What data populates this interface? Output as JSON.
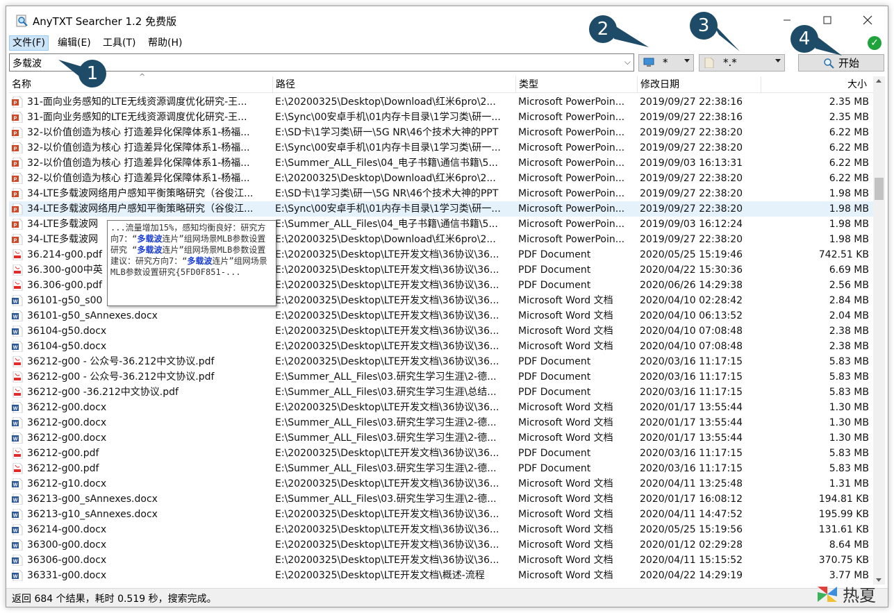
{
  "window": {
    "title": "AnyTXT Searcher 1.2 免费版"
  },
  "menu": [
    {
      "label": "文件(F)",
      "active": true
    },
    {
      "label": "编辑(E)",
      "active": false
    },
    {
      "label": "工具(T)",
      "active": false
    },
    {
      "label": "帮助(H)",
      "active": false
    }
  ],
  "search": {
    "value": "多载波"
  },
  "location_combo": {
    "value": "*"
  },
  "type_combo": {
    "value": "*.*"
  },
  "start_button": {
    "label": "开始"
  },
  "callouts": [
    "1",
    "2",
    "3",
    "4"
  ],
  "columns": {
    "name": "名称",
    "path": "路径",
    "type": "类型",
    "date": "修改日期",
    "size": "大小"
  },
  "rows": [
    {
      "icon": "ppt",
      "name": "31-面向业务感知的LTE无线资源调度优化研究-王...",
      "path": "E:\\20200325\\Desktop\\Download\\红米6pro\\2...",
      "type": "Microsoft PowerPoin...",
      "date": "2019/09/27  22:38:16",
      "size": "2.35 MB"
    },
    {
      "icon": "ppt",
      "name": "31-面向业务感知的LTE无线资源调度优化研究-王...",
      "path": "E:\\Sync\\00安卓手机\\01内存卡目录\\1学习类\\研一...",
      "type": "Microsoft PowerPoin...",
      "date": "2019/09/27  22:38:16",
      "size": "2.35 MB"
    },
    {
      "icon": "ppt",
      "name": "32-以价值创造为核心 打造差异化保障体系1-杨福...",
      "path": "E:\\SD卡\\1学习类\\研一\\5G NR\\46个技术大神的PPT",
      "type": "Microsoft PowerPoin...",
      "date": "2019/09/27  22:38:20",
      "size": "6.22 MB"
    },
    {
      "icon": "ppt",
      "name": "32-以价值创造为核心 打造差异化保障体系1-杨福...",
      "path": "E:\\Sync\\00安卓手机\\01内存卡目录\\1学习类\\研一...",
      "type": "Microsoft PowerPoin...",
      "date": "2019/09/27  22:38:20",
      "size": "6.22 MB"
    },
    {
      "icon": "ppt",
      "name": "32-以价值创造为核心 打造差异化保障体系1-杨福...",
      "path": "E:\\Summer_ALL_Files\\04_电子书籍\\通信书籍\\5...",
      "type": "Microsoft PowerPoin...",
      "date": "2019/09/03  16:13:31",
      "size": "6.22 MB"
    },
    {
      "icon": "ppt",
      "name": "32-以价值创造为核心 打造差异化保障体系1-杨福...",
      "path": "E:\\20200325\\Desktop\\Download\\红米6pro\\2...",
      "type": "Microsoft PowerPoin...",
      "date": "2019/09/27  22:38:20",
      "size": "6.22 MB"
    },
    {
      "icon": "ppt",
      "name": "34-LTE多载波网络用户感知平衡策略研究（谷俊江...",
      "path": "E:\\SD卡\\1学习类\\研一\\5G NR\\46个技术大神的PPT",
      "type": "Microsoft PowerPoin...",
      "date": "2019/09/27  22:38:20",
      "size": "1.98 MB"
    },
    {
      "icon": "ppt",
      "name": "34-LTE多载波网络用户感知平衡策略研究（谷俊江...",
      "path": "E:\\Sync\\00安卓手机\\01内存卡目录\\1学习类\\研一...",
      "type": "Microsoft PowerPoin...",
      "date": "2019/09/27  22:38:20",
      "size": "1.98 MB",
      "selected": true
    },
    {
      "icon": "ppt",
      "name": "34-LTE多载波网",
      "path": "E:\\Summer_ALL_Files\\04_电子书籍\\通信书籍\\5...",
      "type": "Microsoft PowerPoin...",
      "date": "2019/09/03  16:12:24",
      "size": "1.98 MB"
    },
    {
      "icon": "ppt",
      "name": "34-LTE多载波网",
      "path": "E:\\20200325\\Desktop\\Download\\红米6pro\\2...",
      "type": "Microsoft PowerPoin...",
      "date": "2019/09/27  22:38:20",
      "size": "1.98 MB"
    },
    {
      "icon": "pdf",
      "name": "36.214-g00.pdf",
      "path": "E:\\20200325\\Desktop\\LTE开发文档\\36协议\\36...",
      "type": "PDF Document",
      "date": "2020/05/25  15:19:46",
      "size": "742.51 KB"
    },
    {
      "icon": "pdf",
      "name": "36.300-g00中英",
      "path": "E:\\20200325\\Desktop\\LTE开发文档\\36协议\\36...",
      "type": "PDF Document",
      "date": "2020/04/22  15:30:36",
      "size": "6.69 MB"
    },
    {
      "icon": "pdf",
      "name": "36.306-g00.pdf",
      "path": "E:\\20200325\\Desktop\\LTE开发文档\\36协议\\36...",
      "type": "PDF Document",
      "date": "2020/06/26  14:29:38",
      "size": "2.56 MB"
    },
    {
      "icon": "word",
      "name": "36101-g50_s00",
      "path": "E:\\20200325\\Desktop\\LTE开发文档\\36协议\\36...",
      "type": "Microsoft Word 文档",
      "date": "2020/04/10  02:28:42",
      "size": "2.84 MB"
    },
    {
      "icon": "word",
      "name": "36101-g50_sAnnexes.docx",
      "path": "E:\\20200325\\Desktop\\LTE开发文档\\36协议\\36...",
      "type": "Microsoft Word 文档",
      "date": "2020/04/10  06:13:52",
      "size": "2.04 MB"
    },
    {
      "icon": "word",
      "name": "36104-g50.docx",
      "path": "E:\\20200325\\Desktop\\LTE开发文档\\36协议\\36...",
      "type": "Microsoft Word 文档",
      "date": "2020/04/10  07:08:48",
      "size": "2.38 MB"
    },
    {
      "icon": "word",
      "name": "36104-g50.docx",
      "path": "E:\\20200325\\Desktop\\LTE开发文档\\36协议\\36...",
      "type": "Microsoft Word 文档",
      "date": "2020/04/10  07:08:48",
      "size": "2.38 MB"
    },
    {
      "icon": "pdf",
      "name": "36212-g00 - 公众号-36.212中文协议.pdf",
      "path": "E:\\20200325\\Desktop\\LTE开发文档\\36协议\\36...",
      "type": "PDF Document",
      "date": "2020/03/16  11:17:15",
      "size": "5.83 MB"
    },
    {
      "icon": "pdf",
      "name": "36212-g00 - 公众号-36.212中文协议.pdf",
      "path": "E:\\Summer_ALL_Files\\03.研究生学习生涯\\2-德...",
      "type": "PDF Document",
      "date": "2020/03/16  11:17:15",
      "size": "5.83 MB"
    },
    {
      "icon": "pdf",
      "name": "36212-g00 -36.212中文协议.pdf",
      "path": "E:\\Summer_ALL_Files\\03.研究生学习生涯\\总结...",
      "type": "PDF Document",
      "date": "2020/03/16  11:17:15",
      "size": "5.83 MB"
    },
    {
      "icon": "word",
      "name": "36212-g00.docx",
      "path": "E:\\20200325\\Desktop\\LTE开发文档\\36协议\\36...",
      "type": "Microsoft Word 文档",
      "date": "2020/01/17  13:55:44",
      "size": "1.30 MB"
    },
    {
      "icon": "word",
      "name": "36212-g00.docx",
      "path": "E:\\Summer_ALL_Files\\03.研究生学习生涯\\2-德...",
      "type": "Microsoft Word 文档",
      "date": "2020/01/17  13:55:44",
      "size": "1.30 MB"
    },
    {
      "icon": "word",
      "name": "36212-g00.docx",
      "path": "E:\\Summer_ALL_Files\\03.研究生学习生涯\\2-德...",
      "type": "Microsoft Word 文档",
      "date": "2020/01/17  13:55:44",
      "size": "1.30 MB"
    },
    {
      "icon": "pdf",
      "name": "36212-g00.pdf",
      "path": "E:\\20200325\\Desktop\\LTE开发文档\\36协议\\36...",
      "type": "PDF Document",
      "date": "2020/03/16  11:17:15",
      "size": "5.83 MB"
    },
    {
      "icon": "pdf",
      "name": "36212-g00.pdf",
      "path": "E:\\Summer_ALL_Files\\03.研究生学习生涯\\2-德...",
      "type": "PDF Document",
      "date": "2020/03/16  11:17:15",
      "size": "5.83 MB"
    },
    {
      "icon": "word",
      "name": "36212-g10.docx",
      "path": "E:\\20200325\\Desktop\\LTE开发文档\\36协议\\36...",
      "type": "Microsoft Word 文档",
      "date": "2020/04/11  13:25:48",
      "size": "1.31 MB"
    },
    {
      "icon": "word",
      "name": "36213-g00_sAnnexes.docx",
      "path": "E:\\Summer_ALL_Files\\03.研究生学习生涯\\2-德...",
      "type": "Microsoft Word 文档",
      "date": "2020/01/17  16:08:12",
      "size": "194.81 KB"
    },
    {
      "icon": "word",
      "name": "36213-g10_sAnnexes.docx",
      "path": "E:\\20200325\\Desktop\\LTE开发文档\\36协议\\36...",
      "type": "Microsoft Word 文档",
      "date": "2020/04/11  14:47:52",
      "size": "195.99 KB"
    },
    {
      "icon": "word",
      "name": "36214-g00.docx",
      "path": "E:\\20200325\\Desktop\\LTE开发文档\\36协议\\36...",
      "type": "Microsoft Word 文档",
      "date": "2020/05/25  15:19:56",
      "size": "131.61 KB"
    },
    {
      "icon": "word",
      "name": "36300-g00.docx",
      "path": "E:\\20200325\\Desktop\\LTE开发文档\\36协议\\36...",
      "type": "Microsoft Word 文档",
      "date": "2020/01/12  02:29:28",
      "size": "8.64 MB"
    },
    {
      "icon": "word",
      "name": "36306-g00.docx",
      "path": "E:\\20200325\\Desktop\\LTE开发文档\\36协议\\36...",
      "type": "Microsoft Word 文档",
      "date": "2020/04/11  15:15:52",
      "size": "370.75 KB"
    },
    {
      "icon": "word",
      "name": "36331-g00.docx",
      "path": "E:\\20200325\\Desktop\\LTE开发文档\\概述-流程",
      "type": "Microsoft Word 文档",
      "date": "2020/04/22  14:29:19",
      "size": "3.77 MB"
    }
  ],
  "tooltip": {
    "parts": [
      {
        "text": "...流量增加15%，感知均衡良好：研究方向7：“",
        "hl": false
      },
      {
        "text": "多载波",
        "hl": true
      },
      {
        "text": "连片”组网场景MLB参数设置研究 “",
        "hl": false
      },
      {
        "text": "多载波",
        "hl": true
      },
      {
        "text": "连片”组网场景MLB参数设置建议：研究方向7：“",
        "hl": false
      },
      {
        "text": "多载波",
        "hl": true
      },
      {
        "text": "连片”组网场景MLB参数设置研究{5FD0F851-...",
        "hl": false
      }
    ]
  },
  "status": {
    "text": "返回 684 个结果，耗时 0.519 秒，搜索完成。"
  },
  "watermark": {
    "text": "热夏"
  }
}
